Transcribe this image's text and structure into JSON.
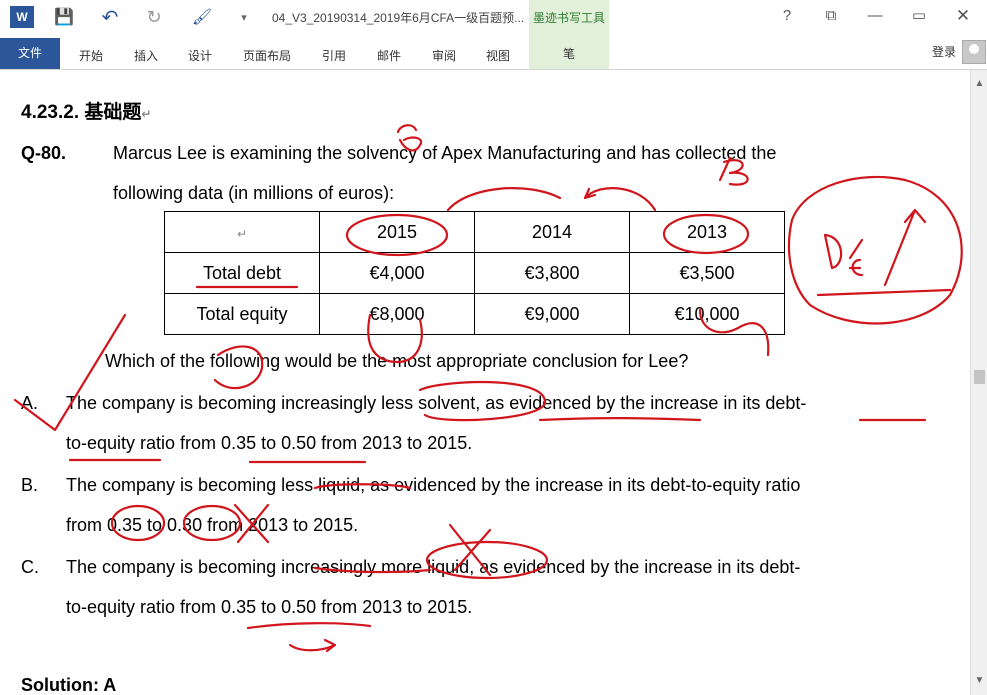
{
  "window": {
    "title": "04_V3_20190314_2019年6月CFA一级百题预...",
    "contextual_tab_title": "墨迹书写工具",
    "contextual_tab_sub": "笔",
    "help": "?",
    "restore": "⧉",
    "minimize": "▭",
    "close": "✕",
    "login": "登录"
  },
  "quick_access": [
    "W",
    "💾",
    "↶",
    "↻",
    "🖌",
    "▾"
  ],
  "ribbon": {
    "file": "文件",
    "tabs": [
      "开始",
      "插入",
      "设计",
      "页面布局",
      "引用",
      "邮件",
      "审阅",
      "视图"
    ]
  },
  "document": {
    "heading": "4.23.2.  基础题",
    "qnum": "Q-80.",
    "stem_line1": "Marcus Lee is examining the solvency of Apex Manufacturing and has collected the",
    "stem_line2": "following data (in millions of euros):",
    "table": {
      "headers": [
        "",
        "2015",
        "2014",
        "2013"
      ],
      "rows": [
        [
          "Total debt",
          "€4,000",
          "€3,800",
          "€3,500"
        ],
        [
          "Total equity",
          "€8,000",
          "€9,000",
          "€10,000"
        ]
      ]
    },
    "question": "Which of the following would be the most appropriate conclusion for Lee?",
    "options": [
      {
        "letter": "A.",
        "line1": "The company is becoming increasingly less solvent, as evidenced by the increase in its debt-",
        "line2": "to-equity ratio from 0.35 to 0.50 from 2013 to 2015."
      },
      {
        "letter": "B.",
        "line1": "The company is becoming less liquid, as evidenced by the increase in its debt-to-equity ratio",
        "line2": "from 0.35 to 0.30 from 2013 to 2015."
      },
      {
        "letter": "C.",
        "line1": "The company is becoming increasingly more liquid, as evidenced by the increase in its debt-",
        "line2": "to-equity ratio from 0.35 to 0.50 from 2013 to 2015."
      }
    ],
    "solution": "Solution: A",
    "pilcrow": "↵"
  },
  "colors": {
    "word_blue": "#2b579a",
    "ink_red": "#d0161c",
    "ink_tab": "#e2efd9"
  }
}
